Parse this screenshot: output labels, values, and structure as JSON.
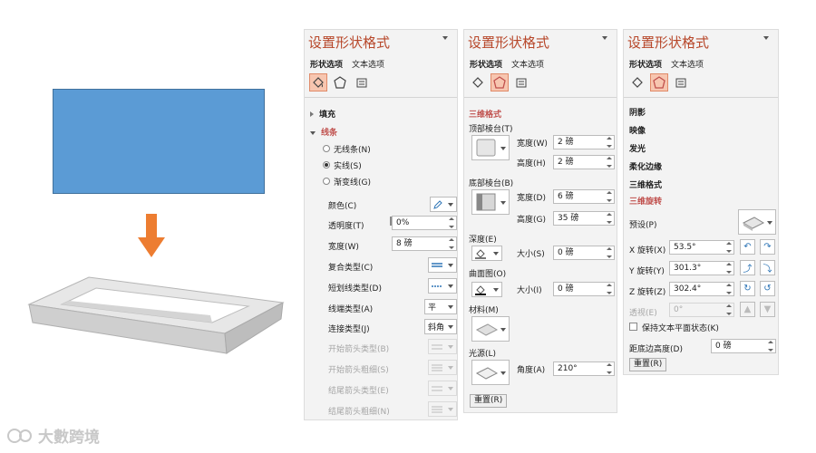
{
  "watermark": "大數跨境",
  "panel_title": "设置形状格式",
  "tabs": {
    "shape": "形状选项",
    "text": "文本选项"
  },
  "icons": [
    "fill-line-icon",
    "effects-icon",
    "size-properties-icon"
  ],
  "panel1": {
    "fill": "填充",
    "line": "线条",
    "radios": [
      "无线条(N)",
      "实线(S)",
      "渐变线(G)"
    ],
    "rows": {
      "color": "颜色(C)",
      "transparency": "透明度(T)",
      "transparency_val": "0%",
      "width": "宽度(W)",
      "width_val": "8 磅",
      "compound": "复合类型(C)",
      "dash": "短划线类型(D)",
      "cap": "线端类型(A)",
      "cap_val": "平",
      "join": "连接类型(J)",
      "join_val": "斜角",
      "begin_type": "开始箭头类型(B)",
      "begin_size": "开始箭头粗细(S)",
      "end_type": "结尾箭头类型(E)",
      "end_size": "结尾箭头粗细(N)"
    }
  },
  "panel2": {
    "section": "三维格式",
    "top_bevel": "顶部棱台(T)",
    "width_label": "宽度(W)",
    "height_label": "高度(H)",
    "top_w": "2 磅",
    "top_h": "2 磅",
    "bottom_bevel": "底部棱台(B)",
    "width_label2": "宽度(D)",
    "height_label2": "高度(G)",
    "bottom_w": "6 磅",
    "bottom_h": "35 磅",
    "depth": "深度(E)",
    "size_label": "大小(S)",
    "depth_val": "0 磅",
    "contour": "曲面图(O)",
    "size_label2": "大小(I)",
    "contour_val": "0 磅",
    "material": "材料(M)",
    "lighting": "光源(L)",
    "angle_label": "角度(A)",
    "angle_val": "210°",
    "reset": "重置(R)"
  },
  "panel3": {
    "sections": [
      "阴影",
      "映像",
      "发光",
      "柔化边缘",
      "三维格式"
    ],
    "active_section": "三维旋转",
    "preset": "预设(P)",
    "x_label": "X 旋转(X)",
    "x_val": "53.5°",
    "y_label": "Y 旋转(Y)",
    "y_val": "301.3°",
    "z_label": "Z 旋转(Z)",
    "z_val": "302.4°",
    "perspective_label": "透视(E)",
    "perspective_val": "0°",
    "keep_flat": "保持文本平面状态(K)",
    "distance_label": "距底边高度(D)",
    "distance_val": "0 磅",
    "reset": "重置(R)"
  },
  "colors": {
    "shape_fill": "#5b9bd5",
    "arrow": "#ed7d31",
    "title": "#b7472a",
    "section_red": "#c0504d",
    "selected_tab_bg": "#f7c6b0"
  }
}
